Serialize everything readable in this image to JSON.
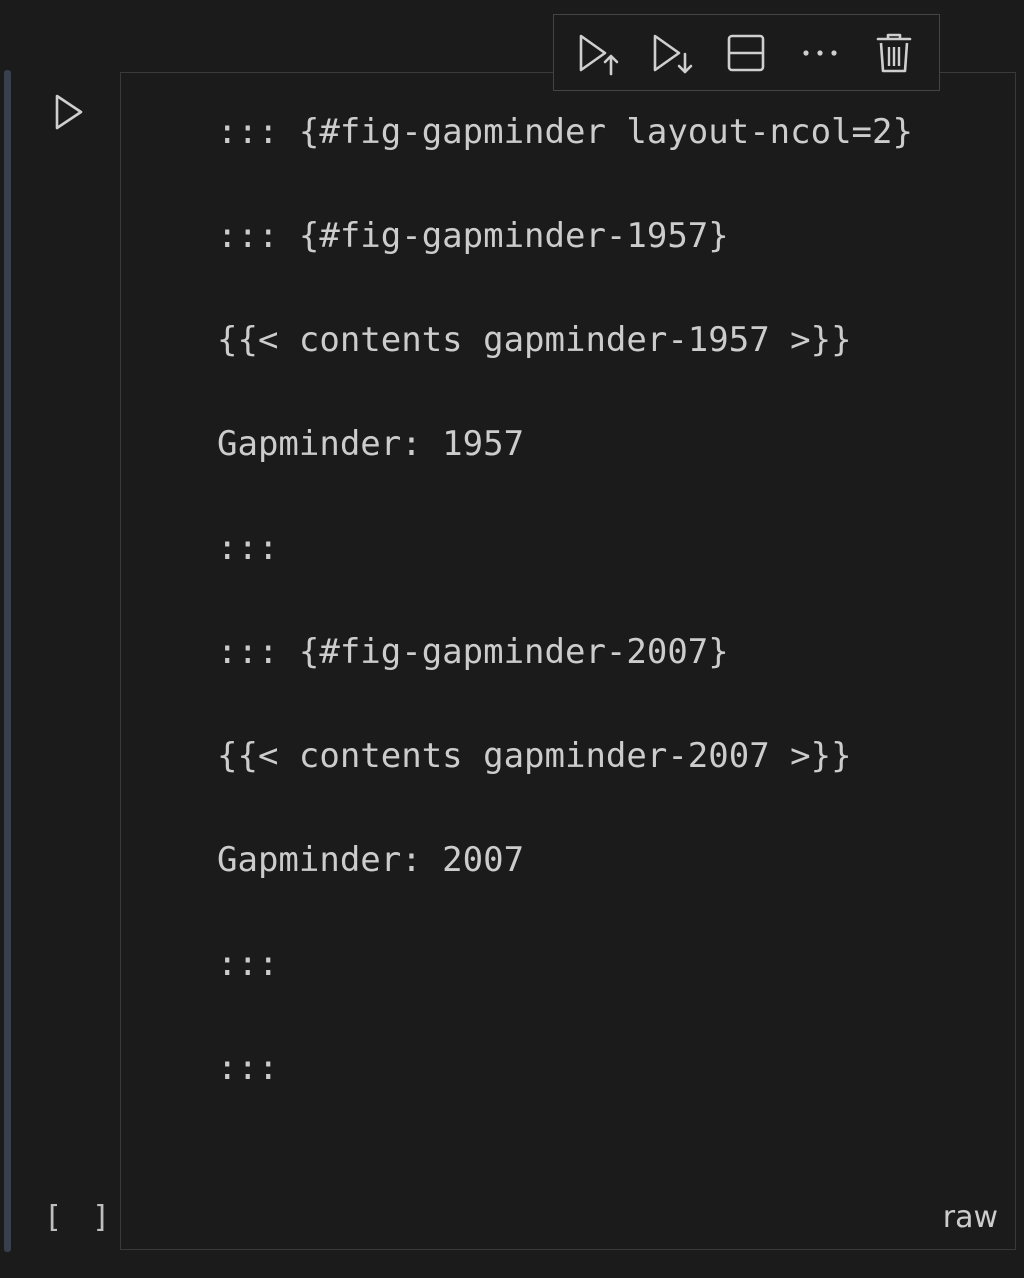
{
  "cell": {
    "execution_count": "[ ]",
    "language": "raw",
    "source_lines": [
      "::: {#fig-gapminder layout-ncol=2}",
      "::: {#fig-gapminder-1957}",
      "{{< contents gapminder-1957 >}}",
      "Gapminder: 1957",
      ":::",
      "::: {#fig-gapminder-2007}",
      "{{< contents gapminder-2007 >}}",
      "Gapminder: 2007",
      ":::",
      ":::"
    ]
  },
  "toolbar": {
    "buttons": [
      {
        "name": "execute-above-button",
        "icon": "run-above-icon"
      },
      {
        "name": "execute-below-button",
        "icon": "run-below-icon"
      },
      {
        "name": "split-cell-button",
        "icon": "split-cell-icon"
      },
      {
        "name": "more-actions-button",
        "icon": "ellipsis-icon"
      },
      {
        "name": "delete-cell-button",
        "icon": "trash-icon"
      }
    ]
  },
  "colors": {
    "background": "#1b1b1c",
    "text": "#cccccc",
    "border": "#3a3a3a",
    "focus_indicator": "#37404c"
  }
}
